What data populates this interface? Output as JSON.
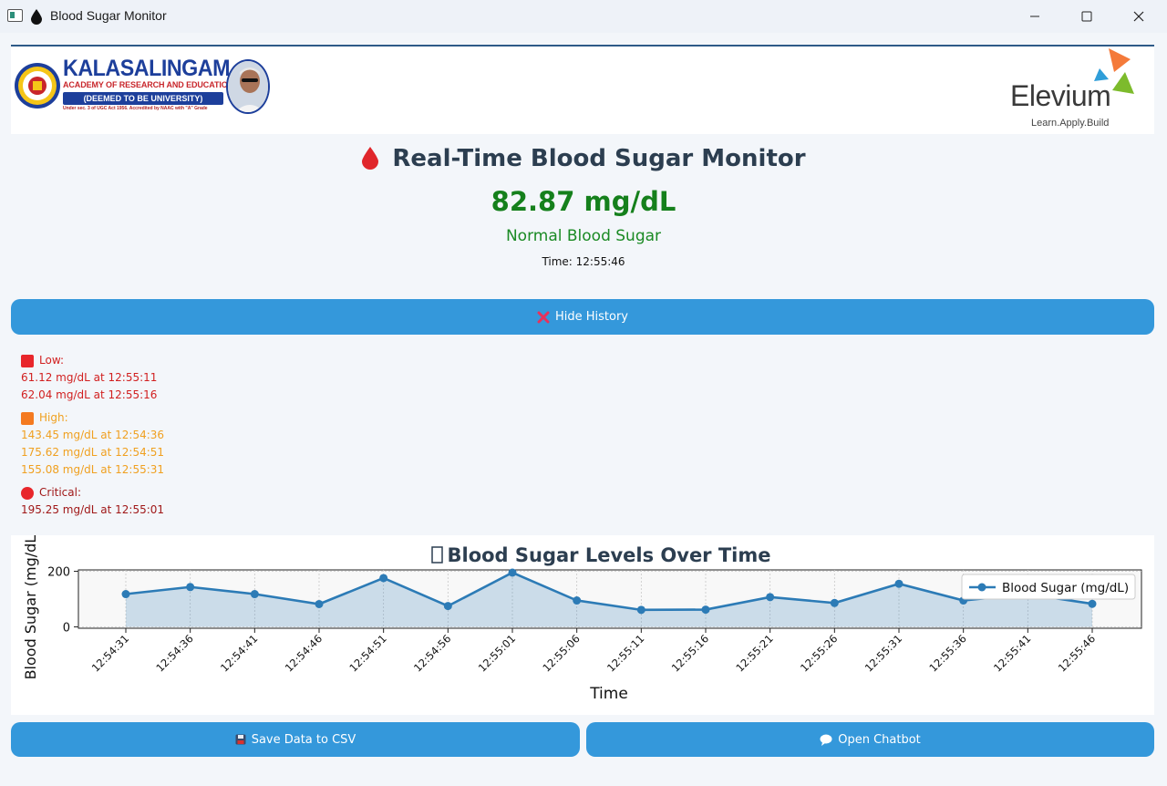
{
  "window": {
    "title": "Blood Sugar Monitor"
  },
  "banner": {
    "university_name": "KALASALINGAM",
    "university_subtitle": "ACADEMY OF RESEARCH AND EDUCATION",
    "university_deemed": "(DEEMED TO BE UNIVERSITY)",
    "university_note": "Under sec. 3 of UGC Act 1956. Accredited by NAAC with \"A\" Grade",
    "partner_name": "Elevium",
    "partner_tagline": "Learn.Apply.Build"
  },
  "reading": {
    "title": "Real-Time Blood Sugar Monitor",
    "value": "82.87 mg/dL",
    "status": "Normal Blood Sugar",
    "time": "Time: 12:55:46"
  },
  "buttons": {
    "hide_history": "Hide History",
    "save_csv": "Save Data to CSV",
    "open_chatbot": "Open Chatbot"
  },
  "history": {
    "low_label": "Low:",
    "low": [
      "61.12 mg/dL at 12:55:11",
      "62.04 mg/dL at 12:55:16"
    ],
    "high_label": "High:",
    "high": [
      "143.45 mg/dL at 12:54:36",
      "175.62 mg/dL at 12:54:51",
      "155.08 mg/dL at 12:55:31"
    ],
    "critical_label": "Critical:",
    "critical": [
      "195.25 mg/dL at 12:55:01"
    ]
  },
  "colors": {
    "accent": "#3498db",
    "normal": "#15801c",
    "low": "#d11f1f",
    "high": "#f0a020",
    "critical": "#a01818",
    "series": "#2c7bb6"
  },
  "chart_data": {
    "type": "line",
    "title": "Blood Sugar Levels Over Time",
    "xlabel": "Time",
    "ylabel": "Blood Sugar (mg/dL)",
    "x": [
      "12:54:31",
      "12:54:36",
      "12:54:41",
      "12:54:46",
      "12:54:51",
      "12:54:56",
      "12:55:01",
      "12:55:06",
      "12:55:11",
      "12:55:16",
      "12:55:21",
      "12:55:26",
      "12:55:31",
      "12:55:36",
      "12:55:41",
      "12:55:46"
    ],
    "series": [
      {
        "name": "Blood Sugar (mg/dL)",
        "values": [
          118,
          143.45,
          118,
          82,
          175.62,
          75,
          195.25,
          95,
          61.12,
          62.04,
          107,
          86,
          155.08,
          95,
          118,
          82.87
        ]
      }
    ],
    "yticks": [
      0,
      200
    ],
    "ylim": [
      -5,
      205
    ],
    "grid": true,
    "filled": true,
    "legend": "top-right"
  }
}
